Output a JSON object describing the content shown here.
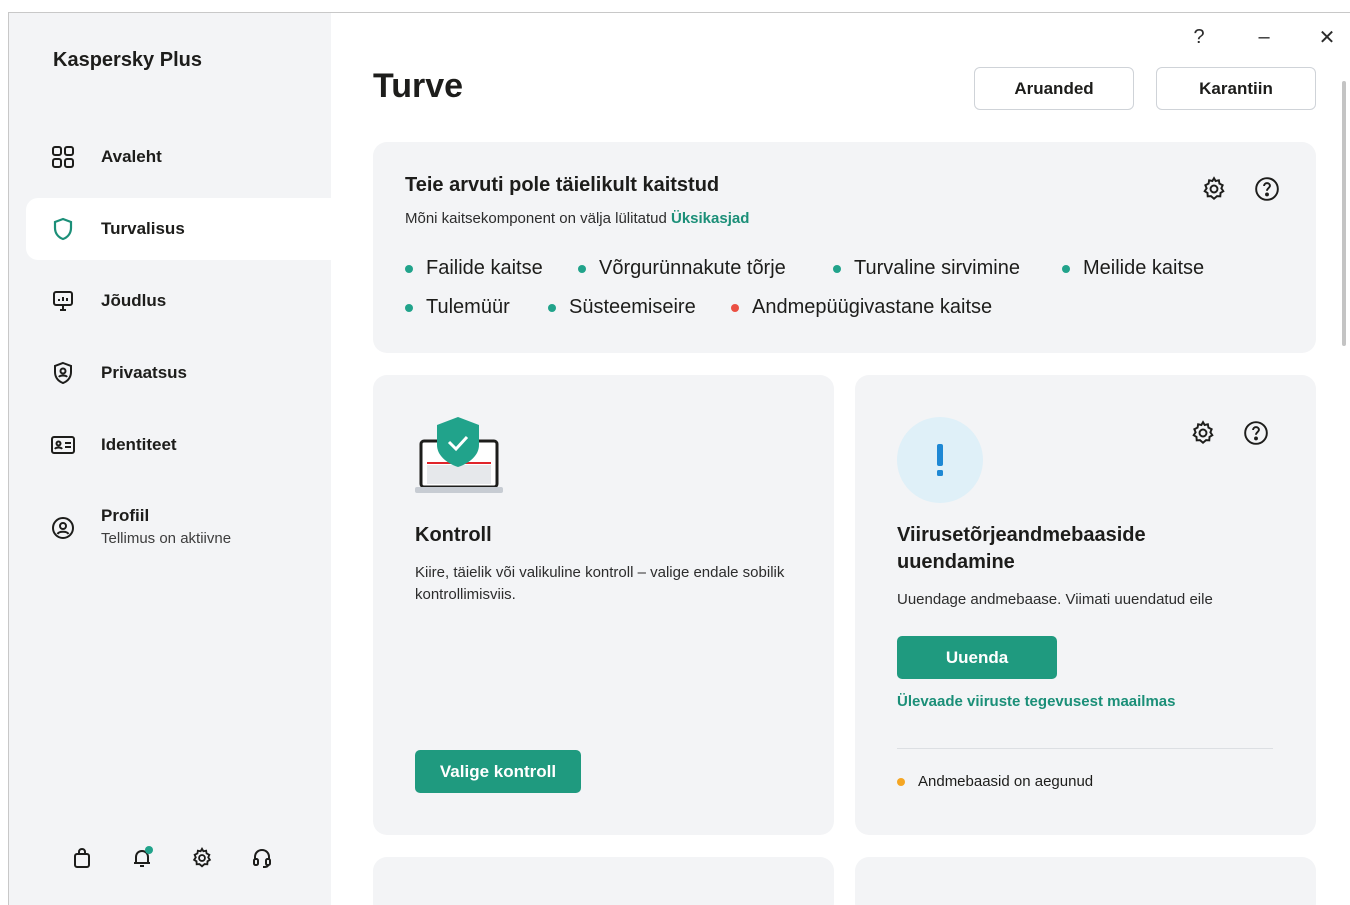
{
  "app": {
    "name": "Kaspersky Plus"
  },
  "titlebar": {
    "help": "?",
    "minimize": "–",
    "close": "✕"
  },
  "sidebar": {
    "items": [
      {
        "label": "Avaleht",
        "icon": "grid-icon"
      },
      {
        "label": "Turvalisus",
        "icon": "shield-icon"
      },
      {
        "label": "Jõudlus",
        "icon": "monitor-icon"
      },
      {
        "label": "Privaatsus",
        "icon": "privacy-shield-icon"
      },
      {
        "label": "Identiteet",
        "icon": "id-card-icon"
      },
      {
        "label": "Profiil",
        "sub": "Tellimus on aktiivne",
        "icon": "user-icon"
      }
    ],
    "bottom_icons": [
      "shopping-bag-icon",
      "bell-icon",
      "gear-icon",
      "headset-icon"
    ]
  },
  "header": {
    "title": "Turve",
    "reports_label": "Aruanded",
    "quarantine_label": "Karantiin"
  },
  "status": {
    "title": "Teie arvuti pole täielikult kaitstud",
    "subtitle": "Mõni kaitsekomponent on välja lülitatud",
    "details_link": "Üksikasjad",
    "components": [
      {
        "label": "Failide kaitse",
        "state": "green"
      },
      {
        "label": "Võrgurünnakute tõrje",
        "state": "green"
      },
      {
        "label": "Turvaline sirvimine",
        "state": "green"
      },
      {
        "label": "Meilide kaitse",
        "state": "green"
      },
      {
        "label": "Tulemüür",
        "state": "green"
      },
      {
        "label": "Süsteemiseire",
        "state": "green"
      },
      {
        "label": "Andmepüügivastane kaitse",
        "state": "red"
      }
    ]
  },
  "scan_card": {
    "title": "Kontroll",
    "description": "Kiire, täielik või valikuline kontroll – valige endale sobilik kontrollimisviis.",
    "button": "Valige kontroll"
  },
  "update_card": {
    "title": "Viirusetõrjeandmebaaside uuendamine",
    "description": "Uuendage andmebaase. Viimati uuendatud eile",
    "button": "Uuenda",
    "link": "Ülevaade viiruste tegevusest maailmas",
    "status": "Andmebaasid on aegunud"
  },
  "colors": {
    "accent": "#1f9a7f",
    "link": "#1b8f78",
    "ok": "#21a38b",
    "error": "#eb5043",
    "warning": "#f5a623",
    "sidebar_bg": "#f3f4f6"
  }
}
